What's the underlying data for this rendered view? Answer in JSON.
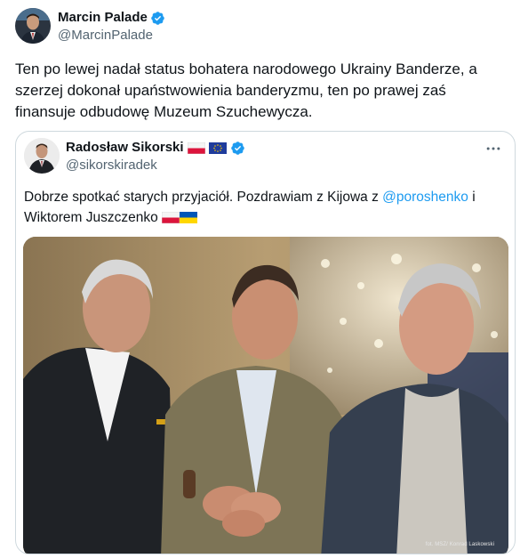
{
  "author": {
    "name": "Marcin Palade",
    "handle": "@MarcinPalade",
    "verified": true
  },
  "tweet": {
    "text": "Ten po lewej nadał status bohatera narodowego Ukrainy Banderze, a szerzej dokonał upaństwowienia banderyzmu, ten po prawej zaś finansuje odbudowę Muzeum Szuchewycza."
  },
  "quoted": {
    "author": {
      "name": "Radosław Sikorski",
      "handle": "@sikorskiradek",
      "verified": true,
      "name_flags": [
        "flag-poland-icon",
        "flag-eu-icon"
      ]
    },
    "text_before": "Dobrze spotkać starych przyjaciół. Pozdrawiam z Kijowa z ",
    "mention": "@poroshenko",
    "text_after": " i Wiktorem Juszczenko",
    "text_flags": [
      "flag-poland-icon",
      "flag-ukraine-icon"
    ],
    "photo": {
      "credit": "fot. MSZ/ Konrad Laskowski"
    }
  },
  "colors": {
    "text": "#0f1419",
    "secondary": "#536471",
    "link": "#1d9bf0",
    "verified": "#1d9bf0",
    "border": "#cfd9de"
  }
}
